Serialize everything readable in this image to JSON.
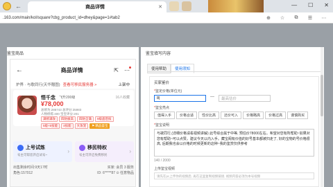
{
  "browser": {
    "tab_title": "商品详情",
    "url": ".163.com/main/kol/square?cbg_product_id=dhey&page=1#tab2"
  },
  "left": {
    "section_title": "鉴宝商品",
    "phone_title": "商品详情",
    "seller_text": "炉界 · 与歌同行(天华赠图)",
    "seller_link": "查看可移民服务器 >",
    "seller_status": "上架中",
    "char_name": "悟千念",
    "char_level": "飞升200级",
    "char_views": "16人收藏",
    "price": "¥78,000",
    "attrs": [
      "总修为:286743  总评分:35983",
      "人物修炼:400  宝宝评分:201"
    ],
    "tags": [
      "满修满攻",
      "四防拔高",
      "四防全满",
      "9级盗后技",
      "5级+5技能",
      "4技能",
      "大攻宠"
    ],
    "gold_tag": "⚑ 精品鉴宝",
    "action_up_title": "上号试炼",
    "action_up_sub": "号主可帮您开启试号~",
    "action_move_title": "移民特权",
    "action_move_sub": "号主可开启免费移民",
    "info_rows": [
      [
        "出售剩余时间:9天17时",
        "买家: 会员 3 服务"
      ],
      [
        "角色:157012",
        "ID: 6*****87  ⊙ 任意物品"
      ]
    ]
  },
  "right": {
    "section_title": "鉴宝填写内容",
    "tabs": [
      "使用帮助",
      "使用须知"
    ],
    "form_head": "买家鉴价",
    "price_label": "鉴定价格(单位元)",
    "price_value": "8|",
    "price_placeholder": "最高估价",
    "points_label": "鉴宝亮点",
    "point_buttons": [
      "值得入手",
      "价格合适",
      "性价比高",
      "还价可入",
      "价格略高",
      "价格过高",
      "谨慎购买"
    ],
    "desc_label": "鉴宝说明",
    "desc_text": "与歌同行,(详细价格请看视频讲解) 此号综合属于中等, 预估价78000左右。希望对您有所帮助~如果对您有帮助~可以点赞。建议今天以内入手。藏宝阁有价值的好号基本都被扫走了, 好的宝物的号价格很高, 后期我也会以价格的时候更新的这种~我的鉴赏仅供参考",
    "counter": "140 / 2000",
    "upload_label": "上传鉴宝视频",
    "upload_placeholder": "请先在pc上传你的视频后, 再在这里复制视频链接, 视频内容必须为本号视频"
  }
}
